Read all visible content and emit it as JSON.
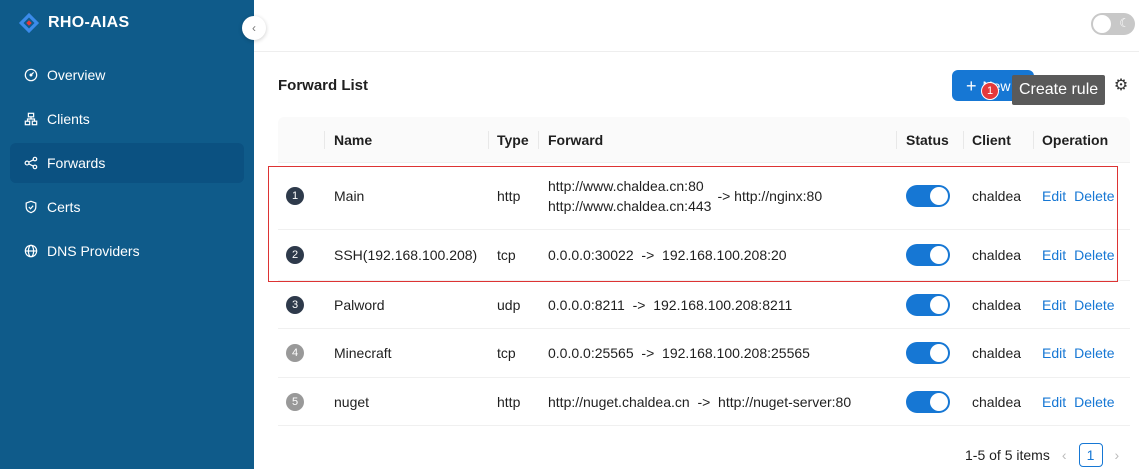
{
  "brand": {
    "name": "RHO-AIAS",
    "logo_icon": "diamond-logo-icon"
  },
  "colors": {
    "sidebar": "#0f5b8a",
    "primary": "#1677d4",
    "danger": "#e5393b"
  },
  "sidebar": {
    "items": [
      {
        "label": "Overview",
        "icon": "dashboard-icon",
        "active": false
      },
      {
        "label": "Clients",
        "icon": "sitemap-icon",
        "active": false
      },
      {
        "label": "Forwards",
        "icon": "share-nodes-icon",
        "active": true
      },
      {
        "label": "Certs",
        "icon": "shield-icon",
        "active": false
      },
      {
        "label": "DNS Providers",
        "icon": "globe-icon",
        "active": false
      }
    ]
  },
  "header": {
    "card_title": "Forward List"
  },
  "toolbar": {
    "new_label": "New",
    "badge_count": "1",
    "tooltip": "Create rule"
  },
  "table": {
    "columns": [
      "Name",
      "Type",
      "Forward",
      "Status",
      "Client",
      "Operation"
    ],
    "rows": [
      {
        "index": "1",
        "name": "Main",
        "type": "http",
        "forward_from_1": "http://www.chaldea.cn:80",
        "forward_from_2": "http://www.chaldea.cn:443",
        "forward_to": "->  http://nginx:80",
        "status": true,
        "client": "chaldea"
      },
      {
        "index": "2",
        "name": "SSH(192.168.100.208)",
        "type": "tcp",
        "forward": "0.0.0.0:30022  ->  192.168.100.208:20",
        "status": true,
        "client": "chaldea"
      },
      {
        "index": "3",
        "name": "Palword",
        "type": "udp",
        "forward": "0.0.0.0:8211  ->  192.168.100.208:8211",
        "status": true,
        "client": "chaldea"
      },
      {
        "index": "4",
        "name": "Minecraft",
        "type": "tcp",
        "forward": "0.0.0.0:25565  ->  192.168.100.208:25565",
        "status": true,
        "client": "chaldea"
      },
      {
        "index": "5",
        "name": "nuget",
        "type": "http",
        "forward": "http://nuget.chaldea.cn  ->  http://nuget-server:80",
        "status": true,
        "client": "chaldea"
      }
    ],
    "edit_label": "Edit",
    "delete_label": "Delete"
  },
  "pagination": {
    "summary": "1-5 of 5 items",
    "current_page": "1"
  }
}
